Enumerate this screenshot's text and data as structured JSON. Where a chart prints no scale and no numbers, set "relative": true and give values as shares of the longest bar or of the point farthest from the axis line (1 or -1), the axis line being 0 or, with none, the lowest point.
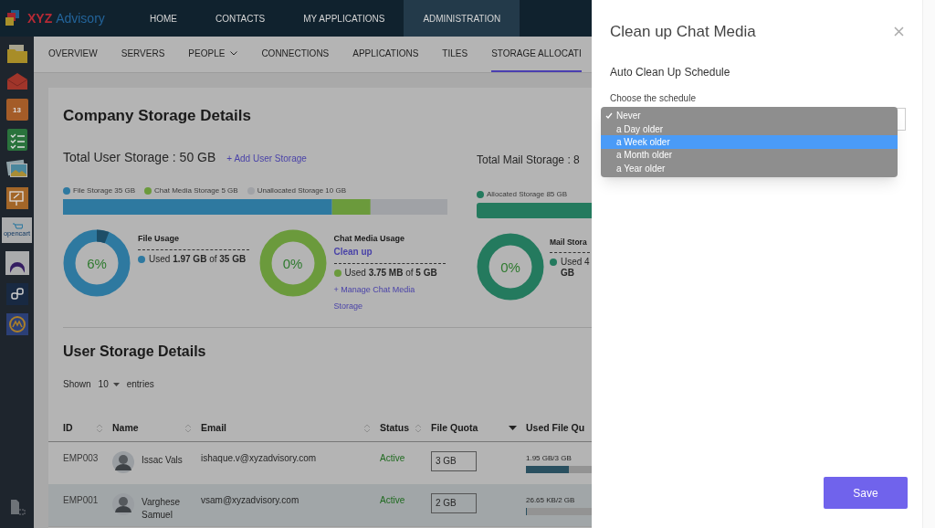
{
  "brand": {
    "name_1": "XYZ",
    "name_2": "Advisory"
  },
  "top_nav": [
    {
      "label": "HOME",
      "selected": false
    },
    {
      "label": "CONTACTS",
      "selected": false
    },
    {
      "label": "MY APPLICATIONS",
      "selected": false
    },
    {
      "label": "ADMINISTRATION",
      "selected": true
    }
  ],
  "sidebar": {
    "apps": [
      {
        "kind": "folder"
      },
      {
        "kind": "mail"
      },
      {
        "kind": "calendar",
        "label": "13"
      },
      {
        "kind": "checklist"
      },
      {
        "kind": "photos"
      },
      {
        "kind": "whiteboard"
      },
      {
        "kind": "cart",
        "label": "opencart"
      },
      {
        "kind": "crescent"
      },
      {
        "kind": "link"
      },
      {
        "kind": "gauge"
      }
    ]
  },
  "tabs": [
    {
      "label": "OVERVIEW",
      "selected": false,
      "dropdown": false
    },
    {
      "label": "SERVERS",
      "selected": false,
      "dropdown": false
    },
    {
      "label": "PEOPLE",
      "selected": false,
      "dropdown": true
    },
    {
      "label": "CONNECTIONS",
      "selected": false,
      "dropdown": false
    },
    {
      "label": "APPLICATIONS",
      "selected": false,
      "dropdown": false
    },
    {
      "label": "TILES",
      "selected": false,
      "dropdown": false
    },
    {
      "label": "STORAGE ALLOCATI",
      "selected": true,
      "dropdown": false
    }
  ],
  "company_storage": {
    "title": "Company Storage Details",
    "user_storage": {
      "total": "Total User Storage : 50 GB",
      "add_link": "+ Add User Storage",
      "chart_data": {
        "type": "bar",
        "orientation": "horizontal",
        "stacked": true,
        "relative": true,
        "legend": "top",
        "series": [
          {
            "name": "File Storage 35 GB",
            "color": "#2e79a0",
            "values": [
              0.7
            ]
          },
          {
            "name": "Chat Media Storage 5 GB",
            "color": "#6b9a3c",
            "values": [
              0.1
            ]
          },
          {
            "name": "Unallocated Storage 10 GB",
            "color": "#a0a2a6",
            "values": [
              0.2
            ]
          }
        ]
      },
      "usages": [
        {
          "title": "File Usage",
          "percent": "6%",
          "level": 0.06,
          "color": "#2e79a0",
          "used_prefix": "Used **1.97 GB** of **35 GB**"
        },
        {
          "title": "Chat Media Usage",
          "link": "Clean up",
          "percent": "0%",
          "level": 0,
          "color": "#6b9a3c",
          "used_prefix": "Used **3.75 MB** of **5 GB**",
          "manage_link": "+ Manage Chat Media Storage"
        }
      ]
    },
    "mail_storage": {
      "total": "Total Mail Storage : 8",
      "segments": [
        {
          "label": "Allocated Storage 85 GB",
          "color": "#247a5e",
          "level": 1
        }
      ],
      "usage": {
        "title": "Mail Stora",
        "percent": "0%",
        "level": 0,
        "color": "#247a5e",
        "used": "Used 4",
        "used_2": "GB"
      }
    }
  },
  "user_storage": {
    "title": "User Storage Details",
    "shown_label": "Shown",
    "page_size": "10",
    "entries_label": "entries",
    "columns": [
      {
        "label": "ID",
        "sortable": true,
        "sorted": false
      },
      {
        "label": "Name",
        "sortable": true,
        "sorted": false
      },
      {
        "label": "Email",
        "sortable": true,
        "sorted": false
      },
      {
        "label": "Status",
        "sortable": true,
        "sorted": false
      },
      {
        "label": "File Quota",
        "sortable": false,
        "sorted": true
      },
      {
        "label": "Used File Qu",
        "sortable": false,
        "sorted": false
      }
    ],
    "rows": [
      {
        "id": "EMP003",
        "name": "Issac Vals",
        "email": "ishaque.v@xyzadvisory.com",
        "status": "Active",
        "quota": "3 GB",
        "used": "1.95 GB/3 GB",
        "level": 0.65,
        "selected": false
      },
      {
        "id": "EMP001",
        "name": "Varghese Samuel",
        "email": "vsam@xyzadvisory.com",
        "status": "Active",
        "quota": "2 GB",
        "used": "26.65 KB/2 GB",
        "level": 0,
        "selected": true
      }
    ]
  },
  "panel": {
    "title": "Clean up Chat Media",
    "section": "Auto Clean Up Schedule",
    "field_label": "Choose the schedule",
    "options": [
      {
        "label": "Never",
        "checked": true,
        "highlighted": false
      },
      {
        "label": "a Day older",
        "checked": false,
        "highlighted": false
      },
      {
        "label": "a Week older",
        "checked": false,
        "highlighted": true
      },
      {
        "label": "a Month older",
        "checked": false,
        "highlighted": false
      },
      {
        "label": "a Year older",
        "checked": false,
        "highlighted": false
      }
    ],
    "save": "Save"
  }
}
